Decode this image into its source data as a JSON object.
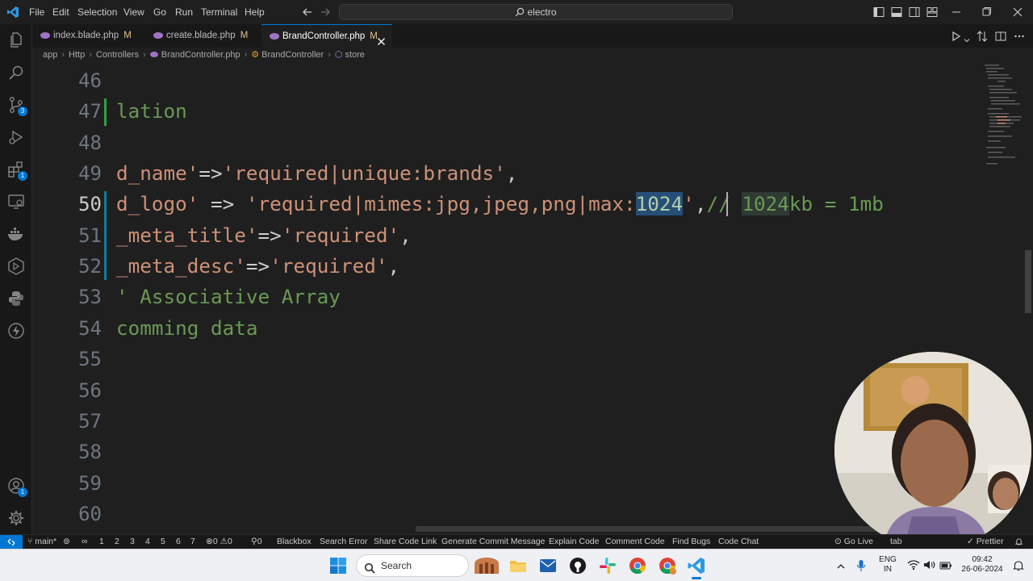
{
  "menu": [
    "File",
    "Edit",
    "Selection",
    "View",
    "Go",
    "Run",
    "Terminal",
    "Help"
  ],
  "search": {
    "text": "electro"
  },
  "tabs": [
    {
      "label": "index.blade.php",
      "modified": "M"
    },
    {
      "label": "create.blade.php",
      "modified": "M"
    },
    {
      "label": "BrandController.php",
      "modified": "M"
    }
  ],
  "breadcrumb": [
    "app",
    "Http",
    "Controllers",
    "BrandController.php",
    "BrandController",
    "store"
  ],
  "activity_badges": {
    "source_control": "3",
    "extensions": "1",
    "accounts": "1"
  },
  "editor": {
    "line_numbers": [
      "46",
      "47",
      "48",
      "49",
      "50",
      "51",
      "52",
      "53",
      "54",
      "55",
      "56",
      "57",
      "58",
      "59",
      "60"
    ],
    "current_line": "50",
    "lines": {
      "l47": "lation",
      "l49_key": "d_name'",
      "l49_op": "=>",
      "l49_val": "'required|unique:brands'",
      "l49_end": ",",
      "l50_key": "d_logo'",
      "l50_op": " => ",
      "l50_val_a": "'required|mimes:jpg,jpeg,png|max:",
      "l50_sel": "1024",
      "l50_val_b": "'",
      "l50_end": ",",
      "l50_cmt_a": "// ",
      "l50_cmt_hl": "1024",
      "l50_cmt_b": "kb = 1mb",
      "l51_key": "_meta_title'",
      "l51_op": "=>",
      "l51_val": "'required'",
      "l51_end": ",",
      "l52_key": "_meta_desc'",
      "l52_op": "=>",
      "l52_val": "'required'",
      "l52_end": ",",
      "l53": "' Associative Array",
      "l54": "comming data"
    }
  },
  "statusbar": {
    "branch": "main*",
    "infinity": "∞",
    "numbers": [
      "1",
      "2",
      "3",
      "4",
      "5",
      "6",
      "7"
    ],
    "errors": "0",
    "warnings": "0",
    "ports": "0",
    "items": [
      "Blackbox",
      "Search Error",
      "Share Code Link",
      "Generate Commit Message",
      "Explain Code",
      "Comment Code",
      "Find Bugs",
      "Code Chat"
    ],
    "go_live": "Go Live",
    "tab": "tab",
    "prettier": "Prettier"
  },
  "taskbar": {
    "search_placeholder": "Search",
    "lang_top": "ENG",
    "lang_bottom": "IN",
    "time": "09:42",
    "date": "26-06-2024"
  },
  "colors": {
    "accent": "#0078d4",
    "string": "#ce9178",
    "comment": "#6a9955",
    "number": "#b5cea8",
    "selection": "#264f78"
  }
}
